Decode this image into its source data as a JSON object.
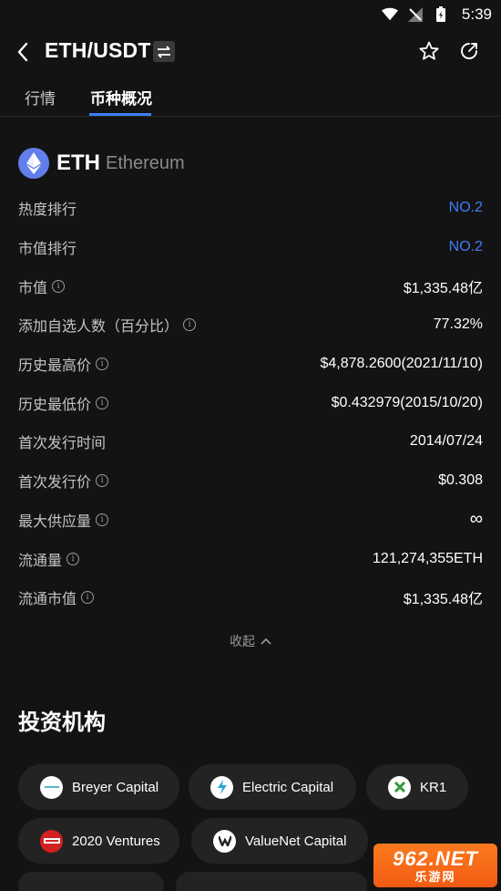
{
  "status_bar": {
    "time": "5:39"
  },
  "header": {
    "pair": "ETH/USDT"
  },
  "tabs": [
    {
      "label": "行情"
    },
    {
      "label": "币种概况"
    }
  ],
  "coin": {
    "symbol": "ETH",
    "name": "Ethereum"
  },
  "rows": [
    {
      "label": "热度排行",
      "value": "NO.2"
    },
    {
      "label": "市值排行",
      "value": "NO.2"
    },
    {
      "label": "市值",
      "value": "$1,335.48亿"
    },
    {
      "label": "添加自选人数（百分比）",
      "value": "77.32%"
    },
    {
      "label": "历史最高价",
      "value": "$4,878.2600(2021/11/10)"
    },
    {
      "label": "历史最低价",
      "value": "$0.432979(2015/10/20)"
    },
    {
      "label": "首次发行时间",
      "value": "2014/07/24"
    },
    {
      "label": "首次发行价",
      "value": "$0.308"
    },
    {
      "label": "最大供应量",
      "value": "∞"
    },
    {
      "label": "流通量",
      "value": "121,274,355ETH"
    },
    {
      "label": "流通市值",
      "value": "$1,335.48亿"
    }
  ],
  "collapse_label": "收起",
  "investors_title": "投资机构",
  "investors": [
    {
      "name": "Breyer Capital"
    },
    {
      "name": "Electric Capital"
    },
    {
      "name": "KR1"
    },
    {
      "name": "2020 Ventures"
    },
    {
      "name": "ValueNet Capital"
    }
  ],
  "watermark": {
    "top": "962.NET",
    "bottom": "乐游网"
  },
  "colors": {
    "accent": "#3f7df6",
    "background": "#131313",
    "eth": "#627eea"
  }
}
